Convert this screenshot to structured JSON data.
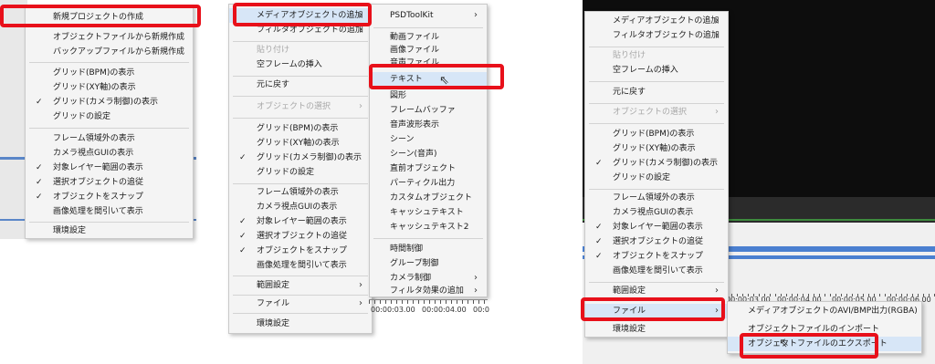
{
  "panel1": {
    "items": [
      {
        "label": "新規プロジェクトの作成"
      },
      {
        "label": "オブジェクトファイルから新規作成"
      },
      {
        "label": "バックアップファイルから新規作成"
      },
      {
        "label": "グリッド(BPM)の表示"
      },
      {
        "label": "グリッド(XY軸)の表示"
      },
      {
        "label": "グリッド(カメラ制御)の表示",
        "check": "✓"
      },
      {
        "label": "グリッドの設定"
      },
      {
        "label": "フレーム領域外の表示"
      },
      {
        "label": "カメラ視点GUIの表示"
      },
      {
        "label": "対象レイヤー範囲の表示",
        "check": "✓"
      },
      {
        "label": "選択オブジェクトの追従",
        "check": "✓"
      },
      {
        "label": "オブジェクトをスナップ",
        "check": "✓"
      },
      {
        "label": "画像処理を間引いて表示"
      },
      {
        "label": "環境設定"
      }
    ]
  },
  "panel2": {
    "items": [
      {
        "label": "メディアオブジェクトの追加",
        "arrow": "›"
      },
      {
        "label": "フィルタオブジェクトの追加",
        "arrow": "›"
      },
      {
        "label": "貼り付け"
      },
      {
        "label": "空フレームの挿入"
      },
      {
        "label": "元に戻す"
      },
      {
        "label": "オブジェクトの選択",
        "arrow": "›"
      },
      {
        "label": "グリッド(BPM)の表示"
      },
      {
        "label": "グリッド(XY軸)の表示"
      },
      {
        "label": "グリッド(カメラ制御)の表示",
        "check": "✓"
      },
      {
        "label": "グリッドの設定"
      },
      {
        "label": "フレーム領域外の表示"
      },
      {
        "label": "カメラ視点GUIの表示"
      },
      {
        "label": "対象レイヤー範囲の表示",
        "check": "✓"
      },
      {
        "label": "選択オブジェクトの追従",
        "check": "✓"
      },
      {
        "label": "オブジェクトをスナップ",
        "check": "✓"
      },
      {
        "label": "画像処理を間引いて表示"
      },
      {
        "label": "範囲設定",
        "arrow": "›"
      },
      {
        "label": "ファイル",
        "arrow": "›"
      },
      {
        "label": "環境設定"
      }
    ],
    "submenu": [
      {
        "label": "PSDToolKit",
        "arrow": "›"
      },
      {
        "label": "動画ファイル"
      },
      {
        "label": "画像ファイル"
      },
      {
        "label": "音声ファイル"
      },
      {
        "label": "テキスト"
      },
      {
        "label": "図形"
      },
      {
        "label": "フレームバッファ"
      },
      {
        "label": "音声波形表示"
      },
      {
        "label": "シーン"
      },
      {
        "label": "シーン(音声)"
      },
      {
        "label": "直前オブジェクト"
      },
      {
        "label": "パーティクル出力"
      },
      {
        "label": "カスタムオブジェクト"
      },
      {
        "label": "キャッシュテキスト"
      },
      {
        "label": "キャッシュテキスト2"
      },
      {
        "label": "時間制御"
      },
      {
        "label": "グループ制御"
      },
      {
        "label": "カメラ制御",
        "arrow": "›"
      },
      {
        "label": "フィルタ効果の追加",
        "arrow": "›"
      }
    ],
    "ruler": [
      "00:00:03.00",
      "00:00:04.00",
      "00:0"
    ]
  },
  "panel3": {
    "items": [
      {
        "label": "メディアオブジェクトの追加",
        "arrow": "›"
      },
      {
        "label": "フィルタオブジェクトの追加",
        "arrow": "›"
      },
      {
        "label": "貼り付け"
      },
      {
        "label": "空フレームの挿入"
      },
      {
        "label": "元に戻す"
      },
      {
        "label": "オブジェクトの選択",
        "arrow": "›"
      },
      {
        "label": "グリッド(BPM)の表示"
      },
      {
        "label": "グリッド(XY軸)の表示"
      },
      {
        "label": "グリッド(カメラ制御)の表示",
        "check": "✓"
      },
      {
        "label": "グリッドの設定"
      },
      {
        "label": "フレーム領域外の表示"
      },
      {
        "label": "カメラ視点GUIの表示"
      },
      {
        "label": "対象レイヤー範囲の表示",
        "check": "✓"
      },
      {
        "label": "選択オブジェクトの追従",
        "check": "✓"
      },
      {
        "label": "オブジェクトをスナップ",
        "check": "✓"
      },
      {
        "label": "画像処理を間引いて表示"
      },
      {
        "label": "範囲設定",
        "arrow": "›"
      },
      {
        "label": "ファイル",
        "arrow": "›"
      },
      {
        "label": "環境設定"
      }
    ],
    "submenu": [
      {
        "label": "メディアオブジェクトのAVI/BMP出力(RGBA)"
      },
      {
        "label": "オブジェクトファイルのインポート"
      },
      {
        "label": "オブジェクトファイルのエクスポート"
      }
    ],
    "ruler": [
      "00:00:03.00",
      "00:00:04.00",
      "00:00:05.00",
      "00:00:06.00"
    ]
  },
  "colors": {
    "highlight": "#e8101a",
    "menu_bg": "#f4f4f4",
    "hover": "#d7e6f7",
    "disabled": "#a8a8a8"
  }
}
